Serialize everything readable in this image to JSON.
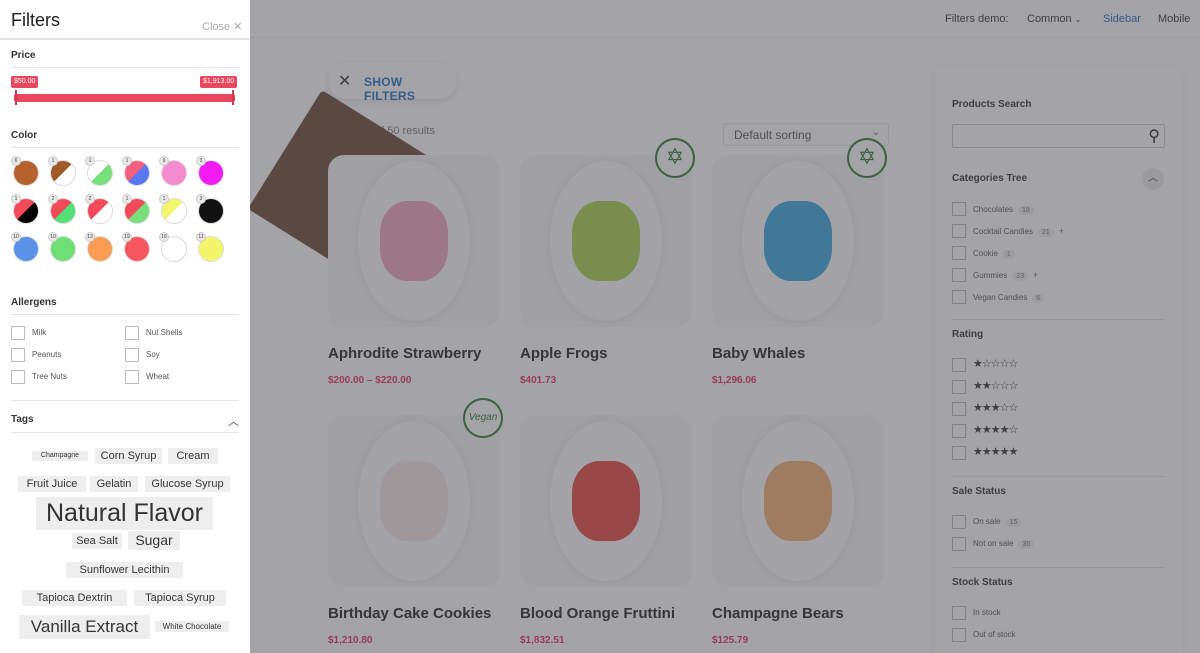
{
  "topnav": {
    "demo_label": "Filters demo:",
    "common": "Common",
    "sidebar": "Sidebar",
    "mobile": "Mobile"
  },
  "main": {
    "show_filters": "SHOW FILTERS",
    "results": "of 50 results",
    "sorting": "Default sorting",
    "products": [
      {
        "name": "Aphrodite Strawberry",
        "price": "$200.00 – $220.00"
      },
      {
        "name": "Apple Frogs",
        "price": "$401.73"
      },
      {
        "name": "Baby Whales",
        "price": "$1,296.06"
      },
      {
        "name": "Birthday Cake Cookies",
        "price": "$1,210.80"
      },
      {
        "name": "Blood Orange Fruttini",
        "price": "$1,832.51"
      },
      {
        "name": "Champagne Bears",
        "price": "$125.79"
      }
    ]
  },
  "right_sidebar": {
    "search_title": "Products Search",
    "categories_title": "Categories Tree",
    "categories": [
      {
        "label": "Chocolates",
        "count": "18",
        "plus": ""
      },
      {
        "label": "Cocktail Candies",
        "count": "21",
        "plus": "+"
      },
      {
        "label": "Cookie",
        "count": "1",
        "plus": ""
      },
      {
        "label": "Gummies",
        "count": "23",
        "plus": "+"
      },
      {
        "label": "Vegan Candies",
        "count": "6",
        "plus": ""
      }
    ],
    "rating_title": "Rating",
    "ratings": [
      "★☆☆☆☆",
      "★★☆☆☆",
      "★★★☆☆",
      "★★★★☆",
      "★★★★★"
    ],
    "sale_title": "Sale Status",
    "sale": [
      {
        "label": "On sale",
        "count": "15"
      },
      {
        "label": "Not on sale",
        "count": "35"
      }
    ],
    "stock_title": "Stock Status",
    "stock": [
      {
        "label": "In stock"
      },
      {
        "label": "Out of stock"
      }
    ]
  },
  "panel": {
    "title": "Filters",
    "close": "Close ✕",
    "price": {
      "title": "Price",
      "min": "$50.00",
      "max": "$1,913.00"
    },
    "color": {
      "title": "Color",
      "swatches": [
        {
          "count": "6",
          "colors": [
            "#b5622d",
            "#b5622d"
          ]
        },
        {
          "count": "1",
          "colors": [
            "#a15a2a",
            "#ffffff"
          ]
        },
        {
          "count": "1",
          "colors": [
            "#ffffff",
            "#77e07a"
          ]
        },
        {
          "count": "1",
          "colors": [
            "#f56080",
            "#5a78f0"
          ]
        },
        {
          "count": "9",
          "colors": [
            "#f48bcf",
            "#f48bcf"
          ]
        },
        {
          "count": "3",
          "colors": [
            "#f21cf2",
            "#f21cf2"
          ]
        },
        {
          "count": "1",
          "colors": [
            "#f24a58",
            "#000000"
          ]
        },
        {
          "count": "2",
          "colors": [
            "#f24a58",
            "#55e078"
          ]
        },
        {
          "count": "2",
          "colors": [
            "#f24a58",
            "#ffffff"
          ]
        },
        {
          "count": "1",
          "colors": [
            "#f24a58",
            "#77e07a"
          ]
        },
        {
          "count": "1",
          "colors": [
            "#f3f56b",
            "#ffffff"
          ]
        },
        {
          "count": "3",
          "colors": [
            "#111111",
            "#111111"
          ]
        },
        {
          "count": "10",
          "colors": [
            "#5a92e8",
            "#5a92e8"
          ]
        },
        {
          "count": "10",
          "colors": [
            "#6ee073",
            "#6ee073"
          ]
        },
        {
          "count": "13",
          "colors": [
            "#fa9c52",
            "#fa9c52"
          ]
        },
        {
          "count": "19",
          "colors": [
            "#f6565d",
            "#f6565d"
          ]
        },
        {
          "count": "16",
          "colors": [
            "#ffffff",
            "#ffffff"
          ]
        },
        {
          "count": "11",
          "colors": [
            "#f3f56b",
            "#f3f56b"
          ]
        }
      ]
    },
    "allergens": {
      "title": "Allergens",
      "items": [
        "Milk",
        "Nut Shells",
        "Peanuts",
        "Soy",
        "Tree Nuts",
        "Wheat"
      ]
    },
    "tags": {
      "title": "Tags",
      "items": [
        "Champagne",
        "Corn Syrup",
        "Cream",
        "Fruit Juice",
        "Gelatin",
        "Glucose Syrup",
        "Natural Flavor",
        "Sea Salt",
        "Sugar",
        "Sunflower Lecithin",
        "Tapioca Dextrin",
        "Tapioca Syrup",
        "Vanilla Extract",
        "White Chocolate"
      ]
    }
  }
}
